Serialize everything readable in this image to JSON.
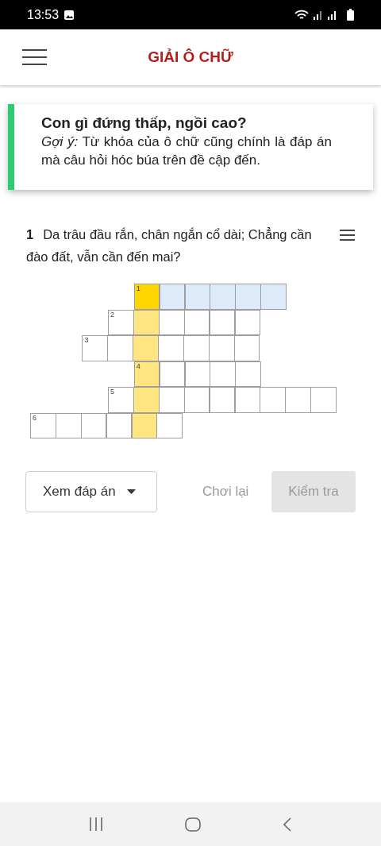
{
  "status_bar": {
    "time": "13:53"
  },
  "header": {
    "title": "GIẢI Ô CHỮ"
  },
  "riddle": {
    "question": "Con gì đứng thấp, ngồi cao?",
    "hint": "*Gợi ý:* Từ khóa của ô chữ cũng chính là đáp án mà câu hỏi hóc búa trên đề cập đến."
  },
  "clue": {
    "number": "1",
    "text": "Da trâu đầu rắn, chân ngắn cổ dài; Chẳng cần đào đất, vẫn cần đến mai?"
  },
  "grid": {
    "rows": [
      {
        "label": "1",
        "cells": [
          {
            "kind": "gap"
          },
          {
            "kind": "gap"
          },
          {
            "kind": "gap"
          },
          {
            "kind": "gap"
          },
          {
            "kind": "active"
          },
          {
            "kind": "sel"
          },
          {
            "kind": "sel"
          },
          {
            "kind": "sel"
          },
          {
            "kind": "sel"
          },
          {
            "kind": "sel"
          }
        ]
      },
      {
        "label": "2",
        "cells": [
          {
            "kind": "gap"
          },
          {
            "kind": "gap"
          },
          {
            "kind": "gap"
          },
          {
            "kind": "box"
          },
          {
            "kind": "key"
          },
          {
            "kind": "box"
          },
          {
            "kind": "box"
          },
          {
            "kind": "box"
          },
          {
            "kind": "box"
          }
        ]
      },
      {
        "label": "3",
        "cells": [
          {
            "kind": "gap"
          },
          {
            "kind": "gap"
          },
          {
            "kind": "box"
          },
          {
            "kind": "box"
          },
          {
            "kind": "key"
          },
          {
            "kind": "box"
          },
          {
            "kind": "box"
          },
          {
            "kind": "box"
          },
          {
            "kind": "box"
          }
        ]
      },
      {
        "label": "4",
        "cells": [
          {
            "kind": "gap"
          },
          {
            "kind": "gap"
          },
          {
            "kind": "gap"
          },
          {
            "kind": "gap"
          },
          {
            "kind": "key"
          },
          {
            "kind": "box"
          },
          {
            "kind": "box"
          },
          {
            "kind": "box"
          },
          {
            "kind": "box"
          }
        ]
      },
      {
        "label": "5",
        "cells": [
          {
            "kind": "gap"
          },
          {
            "kind": "gap"
          },
          {
            "kind": "gap"
          },
          {
            "kind": "box"
          },
          {
            "kind": "key"
          },
          {
            "kind": "box"
          },
          {
            "kind": "box"
          },
          {
            "kind": "box"
          },
          {
            "kind": "box"
          },
          {
            "kind": "box"
          },
          {
            "kind": "box"
          },
          {
            "kind": "box"
          }
        ]
      },
      {
        "label": "6",
        "cells": [
          {
            "kind": "box"
          },
          {
            "kind": "box"
          },
          {
            "kind": "box"
          },
          {
            "kind": "box"
          },
          {
            "kind": "key"
          },
          {
            "kind": "box"
          }
        ]
      }
    ]
  },
  "actions": {
    "answer_menu": "Xem đáp án",
    "replay": "Chơi lại",
    "check": {
      "label": "Kiểm tra",
      "disabled": true
    }
  }
}
